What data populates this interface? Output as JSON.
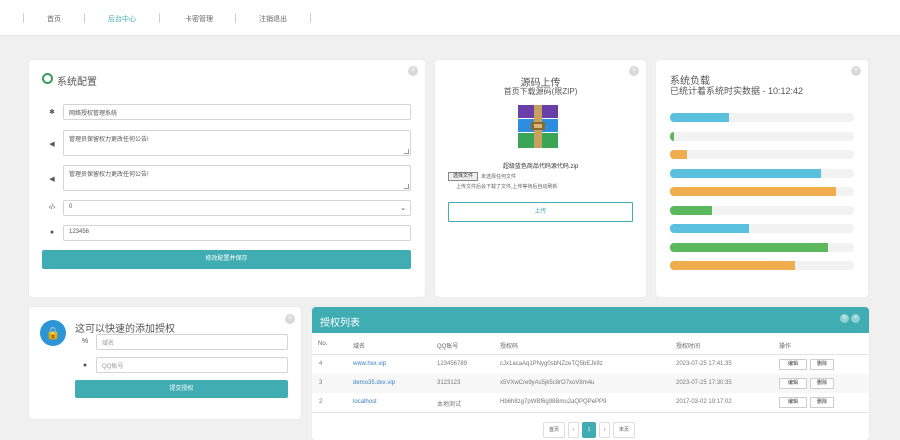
{
  "nav": {
    "items": [
      "首页",
      "后台中心",
      "卡密管理",
      "注销退出"
    ],
    "active_index": 1
  },
  "config": {
    "title": "系统配置",
    "site_name": "网络授权管理系统",
    "notice1": "管理员保留权力更改任何公告!",
    "notice2": "管理员保留权力更改任何公告!",
    "select_value": "0",
    "password": "123456",
    "save_label": "修改配置并保存"
  },
  "upload": {
    "title": "源码上传",
    "subtitle": "首页下载源码(限ZIP)",
    "filename": "超级蓝色商品代码源代码.zip",
    "choose_label": "选择文件",
    "no_file": "未选择任何文件",
    "hint": "上传文件后会下载了文件,上传等待后自动刷新",
    "upload_label": "上传"
  },
  "load": {
    "title": "系统负载",
    "subtitle": "已统计着系统时实数据 - 10:12:42",
    "bars": [
      {
        "value": 0.32,
        "color": "#5bc0de"
      },
      {
        "value": 0.02,
        "color": "#5cb85c"
      },
      {
        "value": 0.09,
        "color": "#f0ad4e"
      },
      {
        "value": 0.82,
        "color": "#5bc0de"
      },
      {
        "value": 0.9,
        "color": "#f0ad4e"
      },
      {
        "value": 0.23,
        "color": "#5cb85c"
      },
      {
        "value": 0.43,
        "color": "#5bc0de"
      },
      {
        "value": 0.86,
        "color": "#5cb85c"
      },
      {
        "value": 0.68,
        "color": "#f0ad4e"
      }
    ]
  },
  "quickadd": {
    "title": "这可以快速的添加授权",
    "domain_placeholder": "域名",
    "qq_placeholder": "QQ账号",
    "submit_label": "提交授权"
  },
  "table": {
    "title": "授权列表",
    "headers": [
      "No.",
      "域名",
      "QQ账号",
      "授权码",
      "授权时间",
      "操作"
    ],
    "rows": [
      {
        "no": "4",
        "domain": "www.hxx.vip",
        "qq": "123456789",
        "code": "cJx1acaAq1PNyg0sbNZzeTQ5bEJk9z",
        "time": "2023-07-25 17:41:35"
      },
      {
        "no": "3",
        "domain": "demo35.dxx.vip",
        "qq": "3123123",
        "code": "x5VXwCre9yAs5jk5c8rO7xoV8m4u",
        "time": "2023-07-25 17:30:35"
      },
      {
        "no": "2",
        "domain": "localhost",
        "qq": "本地测试",
        "code": "Hb6h8zg7pWBf6g98Bmu2aQPQPePP9",
        "time": "2017-03-02 19:17:02"
      }
    ],
    "edit_label": "编辑",
    "delete_label": "删除",
    "pager": {
      "first": "首页",
      "prev": "‹",
      "current": "1",
      "next": "›",
      "last": "末页"
    }
  }
}
